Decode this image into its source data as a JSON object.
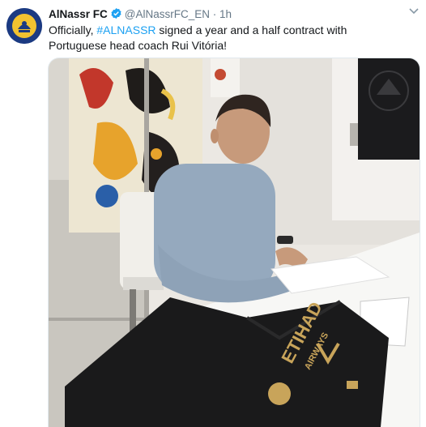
{
  "tweet": {
    "display_name": "AlNassr FC",
    "handle": "@AlNassrFC_EN",
    "separator": "·",
    "time": "1h",
    "text_before": "Officially, ",
    "hashtag": "#ALNASSR",
    "text_after": " signed a year and a half contract with Portuguese head coach Rui Vitória!",
    "menu_icon": "chevron-down-icon"
  },
  "media": {
    "alt_subject": "photo",
    "jersey_text": "ETIHAD AIRWAYS"
  },
  "colors": {
    "link": "#1da1f2",
    "verified": "#1da1f2",
    "meta": "#657786"
  }
}
